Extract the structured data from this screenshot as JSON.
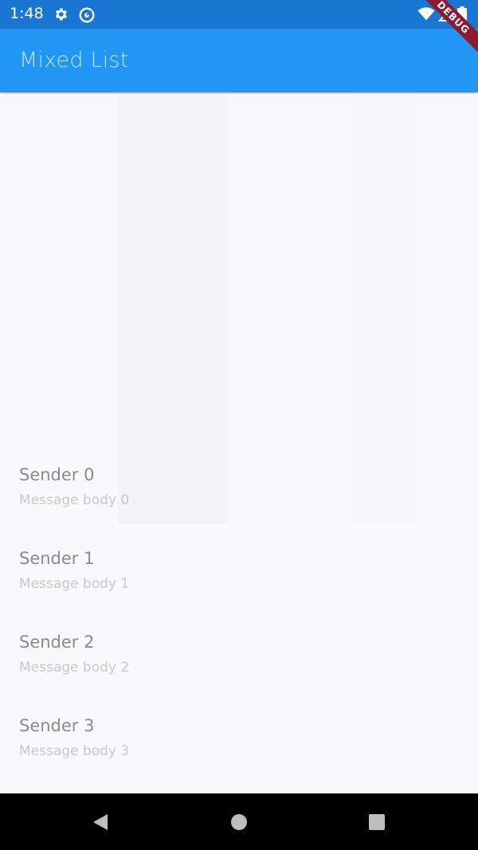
{
  "status_bar": {
    "time": "1:48",
    "icons": [
      "gear-icon",
      "sync-icon",
      "wifi-icon",
      "signal-icon",
      "battery-icon"
    ]
  },
  "app_bar": {
    "title": "Mixed List"
  },
  "debug_banner": {
    "label": "DEBUG"
  },
  "list": {
    "items": [
      {
        "sender": "Sender 0",
        "body": "Message body 0"
      },
      {
        "sender": "Sender 1",
        "body": "Message body 1"
      },
      {
        "sender": "Sender 2",
        "body": "Message body 2"
      },
      {
        "sender": "Sender 3",
        "body": "Message body 3"
      }
    ]
  },
  "nav_bar": {
    "buttons": [
      "back-icon",
      "home-icon",
      "recents-icon"
    ]
  },
  "colors": {
    "status_bar": "#1976d2",
    "app_bar": "#2196f3",
    "debug_banner": "#8b1a35",
    "nav_bar": "#000000",
    "background": "#f9f9fb"
  }
}
